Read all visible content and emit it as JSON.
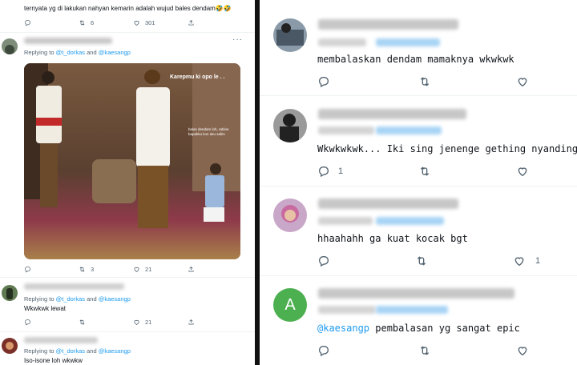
{
  "left_panel": {
    "top_tweet": {
      "text": "ternyata yg di lakukan nahyan kemarin adalah wujud bales dendam🤣🤣",
      "retweets": "6",
      "likes": "301"
    },
    "tweet_photo": {
      "replying_prefix": "Replying to",
      "mention_1": "@t_dorkas",
      "joiner": "and",
      "mention_2": "@kaesangp",
      "photo_caption": "Karepmu ki opo le . .",
      "photo_caption_small": "balas dendam loh, rabine bapakku kon aku salim",
      "retweets": "3",
      "likes": "21"
    },
    "tweet_lewat": {
      "replying_prefix": "Replying to",
      "mention_1": "@t_dorkas",
      "joiner": "and",
      "mention_2": "@kaesangp",
      "text": "Wkwkwk lewat",
      "likes": "21"
    },
    "tweet_iso": {
      "replying_prefix": "Replying to",
      "mention_1": "@t_dorkas",
      "joiner": "and",
      "mention_2": "@kaesangp",
      "text": "Iso-isone loh wkwkw"
    }
  },
  "right_panel": {
    "replies": [
      {
        "text": "membalaskan dendam mamaknya wkwkwk",
        "likes": ""
      },
      {
        "text": "Wkwkwkwk... Iki sing jenenge gething nyanding",
        "replies_count": "1",
        "likes": ""
      },
      {
        "text": "hhaahahh ga kuat kocak bgt",
        "likes": "1"
      },
      {
        "avatar_letter": "A",
        "mention": "@kaesangp",
        "text": " pembalasan yg sangat epic",
        "likes": ""
      }
    ]
  },
  "colors": {
    "link_blue": "#1d9bf0",
    "icon_gray": "#536471",
    "avatar_green": "#4caf50"
  },
  "icons": [
    "reply-icon",
    "retweet-icon",
    "like-icon",
    "more-icon"
  ]
}
